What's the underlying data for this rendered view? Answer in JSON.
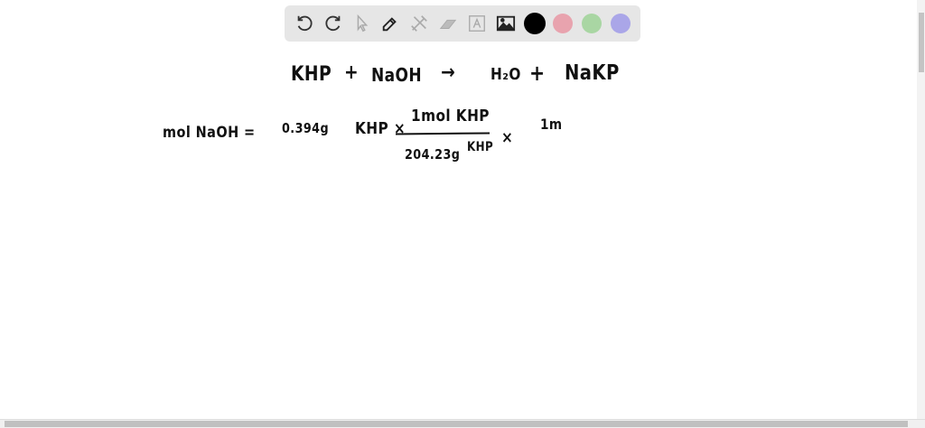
{
  "toolbar": {
    "tools": [
      "undo-icon",
      "redo-icon",
      "select-icon",
      "pen-icon",
      "tools-icon",
      "eraser-icon",
      "text-icon",
      "image-icon"
    ],
    "colors": {
      "black": "#000000",
      "pink": "#e8a3ae",
      "green": "#a9d6a3",
      "purple": "#aaa6e8"
    }
  },
  "canvas": {
    "line1": {
      "reactant1": "KHP",
      "plus1": "+",
      "reactant2": "NaOH",
      "arrow": "→",
      "product1": "H₂O",
      "plus2": "+",
      "product2": "NaKP"
    },
    "line2": {
      "lhs": "mol NaOH =",
      "mass": "0.394g",
      "unit": "KHP ×",
      "numerator": "1mol KHP",
      "denominator": "204.23g",
      "denominator_unit": "KHP",
      "times": "×",
      "partial": "1m"
    }
  }
}
